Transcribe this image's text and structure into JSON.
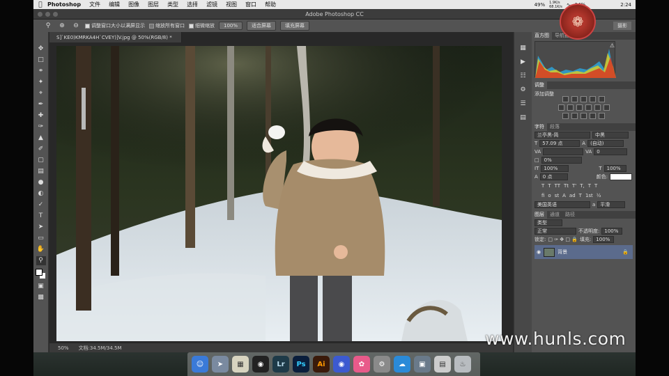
{
  "menubar": {
    "app_name": "Photoshop",
    "items": [
      "文件",
      "编辑",
      "图像",
      "图层",
      "类型",
      "选择",
      "滤镜",
      "视图",
      "窗口",
      "帮助"
    ],
    "battery": "49%",
    "net_up": "1.9K/s",
    "net_down": "68.1K/s",
    "battery2": "14%",
    "clock": "2:24"
  },
  "window": {
    "title": "Adobe Photoshop CC"
  },
  "options": {
    "check1": "调整窗口大小以满屏显示",
    "check2": "缩放所有窗口",
    "check3": "细微缩放",
    "zoom_value": "100%",
    "fit_screen": "适合屏幕",
    "fill_screen": "填充屏幕",
    "workspace": "摄影"
  },
  "document": {
    "tab_title": "S]`KE0)KMRKA4H`CVEY)]V.jpg @ 50%(RGB/8) *",
    "status_zoom": "50%",
    "status_doc": "文档:34.5M/34.5M"
  },
  "watermark": "www.hunls.com",
  "panels": {
    "hist_tabs": [
      "直方图",
      "导航器"
    ],
    "adjust_tab": "调整",
    "add_adjust": "添加调整",
    "char_tabs": [
      "字符",
      "段落"
    ],
    "font_family": "兰亭黑-简",
    "font_style": "中黑",
    "font_size": "57.09 点",
    "leading": "(自动)",
    "kerning": "",
    "tracking": "0",
    "scale_pct": "0%",
    "vscale": "100%",
    "hscale": "100%",
    "baseline": "0 点",
    "color_label": "颜色:",
    "language": "美国英语",
    "antialias_label": "a",
    "antialias": "平滑",
    "layer_tabs": [
      "图层",
      "通道",
      "路径"
    ],
    "kind": "类型",
    "blend": "正常",
    "opacity_label": "不透明度:",
    "opacity": "100%",
    "lock_label": "锁定:",
    "fill_label": "填充:",
    "fill": "100%",
    "layer_name": "背景"
  },
  "colors": {
    "accent_layer": "#5b6b8c",
    "panel_bg": "#535353"
  }
}
